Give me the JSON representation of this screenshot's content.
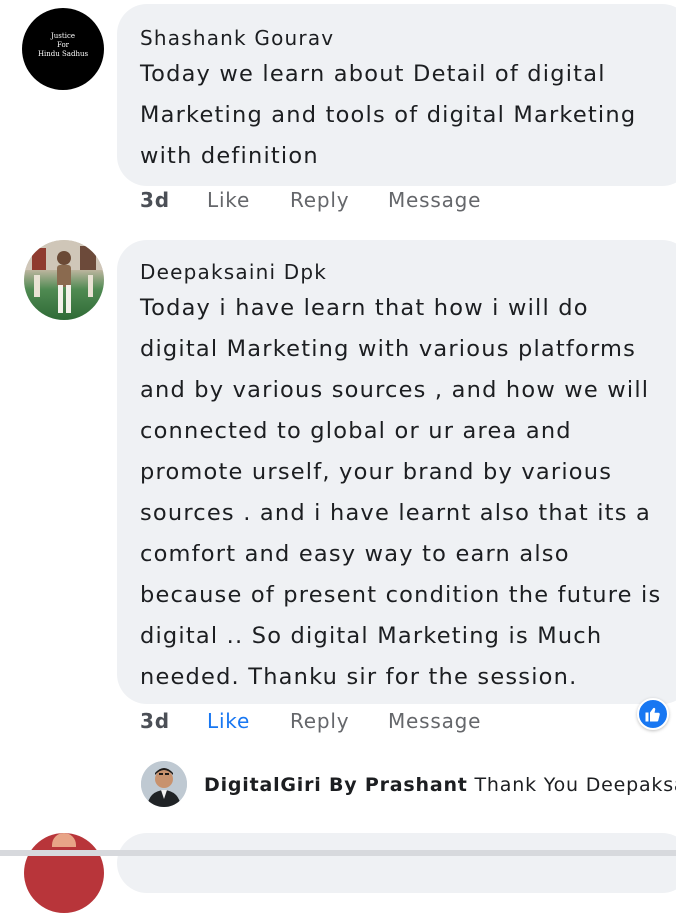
{
  "comments": [
    {
      "avatar_text_lines": [
        "Justice",
        "For",
        "Hindu Sadhus"
      ],
      "author": "Shashank Gourav",
      "text": "Today we learn about Detail of digital Marketing and tools of digital Marketing with definition",
      "time": "3d",
      "actions": {
        "like": "Like",
        "reply": "Reply",
        "message": "Message"
      }
    },
    {
      "author": "Deepaksaini Dpk",
      "text": "Today i have learn that how i will do digital Marketing with various platforms and by various sources , and how we will connected to global or ur area and promote urself, your brand by various sources . and i have learnt also that its a comfort and easy way to earn also because of present condition the future is digital .. So digital Marketing is Much needed. Thanku sir for the session.",
      "time": "3d",
      "actions": {
        "like": "Like",
        "reply": "Reply",
        "message": "Message"
      },
      "liked_by_viewer": true,
      "reaction": "thumbs-up"
    }
  ],
  "reply_preview": {
    "author": "DigitalGiri By Prashant",
    "text": "Thank You Deepaksa·"
  },
  "colors": {
    "bubble": "#eff1f4",
    "action_text": "#65676b",
    "like_active": "#1877f2"
  }
}
